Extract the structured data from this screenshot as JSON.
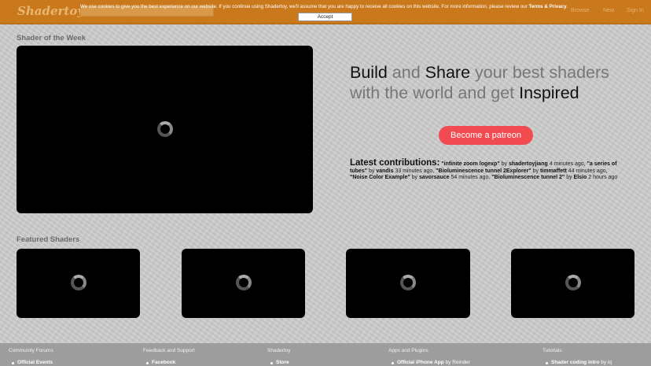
{
  "header": {
    "logo": "Shadertoy",
    "nav": [
      "Browse",
      "New",
      "Sign In"
    ]
  },
  "cookie": {
    "text_pre": "We use cookies to give you the best experience on our website. If you continue using Shadertoy, we'll assume that you are happy to receive all cookies on this website. For more information, please review our ",
    "terms_label": "Terms & Privacy",
    "text_post": ".",
    "accept_label": "Accept"
  },
  "shader_of_week": {
    "title": "Shader of the Week"
  },
  "hero": {
    "w1": "Build",
    "w2": "and",
    "w3": "Share",
    "w4": "your best shaders",
    "w5": "with the world and get",
    "w6": "Inspired"
  },
  "patreon_label": "Become a patreon",
  "contributions": {
    "heading": "Latest contributions:",
    "items": [
      {
        "title": "\"infinite zoom logexp\"",
        "by": "by",
        "author": "shadertoyjiang",
        "time": "4 minutes ago,"
      },
      {
        "title": "\"a series of tubes\"",
        "by": "by",
        "author": "vandis",
        "time": "33 minutes ago,"
      },
      {
        "title": "\"Bioluminescence tunnel 2Explorer\"",
        "by": "by",
        "author": "timmaffett",
        "time": "44 minutes ago,"
      },
      {
        "title": "\"Noise Color Example\"",
        "by": "by",
        "author": "savorsauce",
        "time": "54 minutes ago,"
      },
      {
        "title": "\"Bioluminescence tunnel 2\"",
        "by": "by",
        "author": "Elsio",
        "time": "2 hours ago"
      }
    ]
  },
  "featured": {
    "title": "Featured Shaders"
  },
  "footer": {
    "cols": [
      {
        "heading": "Community Forums",
        "item": "Official Events",
        "extra": ""
      },
      {
        "heading": "Feedback and Support",
        "item": "Facebook",
        "extra": ""
      },
      {
        "heading": "Shadertoy",
        "item": "Store",
        "extra": ""
      },
      {
        "heading": "Apps and Plugins",
        "item": "Official iPhone App",
        "extra": " by Reinder"
      },
      {
        "heading": "Tutorials",
        "item": "Shader coding intro",
        "extra": " by iq"
      }
    ]
  },
  "colors": {
    "header": "#c9781c",
    "patreon": "#f24a51",
    "footer": "#9d9d9d"
  }
}
